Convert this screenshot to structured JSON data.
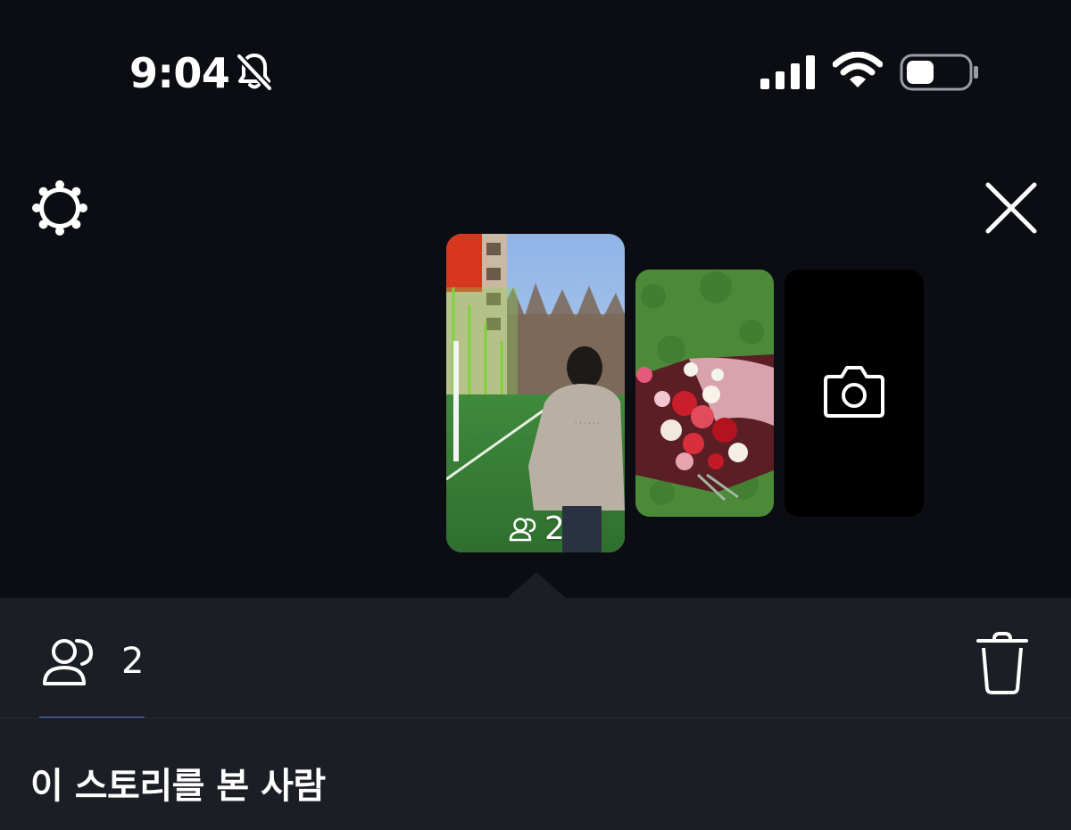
{
  "status_bar": {
    "time": "9:04",
    "icons": [
      "bell-slash-icon",
      "cellular-signal-icon",
      "wifi-icon",
      "battery-icon"
    ]
  },
  "toolbar": {
    "settings_icon": "gear-icon",
    "close_icon": "close-icon"
  },
  "stories": {
    "current_viewer_count": "2",
    "add_story_icon": "camera-icon"
  },
  "sheet": {
    "viewers_tab_count": "2",
    "viewers_tab_icon": "people-icon",
    "delete_icon": "trash-icon",
    "title": "이 스토리를 본 사람"
  },
  "colors": {
    "background": "#0b0d12",
    "sheet_background": "#1c1e25",
    "tab_underline": "#5b6fd6"
  }
}
